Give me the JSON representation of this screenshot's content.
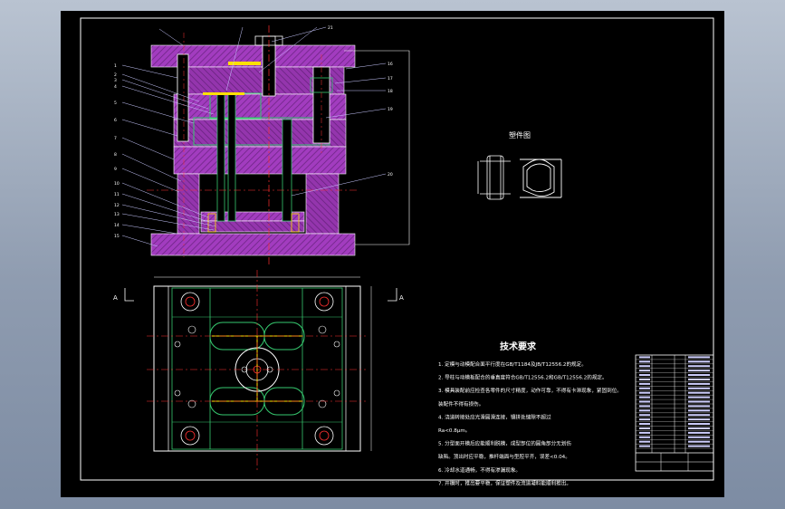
{
  "drawing": {
    "background_color": "#000000",
    "frame_color": "#ffffff",
    "line_colors": {
      "outline": "#ffffff",
      "plate": "#a23cbf",
      "plate_hatch": "#7a2f90",
      "part": "#36c96f",
      "centerline": "#ff3030",
      "section": "#ffe000",
      "leader": "#3a5cff"
    }
  },
  "section_view": {
    "balloons_left": [
      "1",
      "2",
      "3",
      "4",
      "5",
      "6",
      "7",
      "8",
      "9",
      "10",
      "11",
      "12",
      "13",
      "14",
      "15"
    ],
    "balloons_right": [
      "16",
      "17",
      "18",
      "19",
      "20",
      "21"
    ]
  },
  "plan_view": {
    "section_marks": [
      "A",
      "A"
    ]
  },
  "product_view": {
    "title": "塑件图"
  },
  "technical_requirements": {
    "title": "技术要求",
    "items": [
      "1. 定模与动模配合面平行度在GB/T1184及JB/T12556.2的规定。",
      "2. 导柱与动模板配合的垂直度符合GB/T12556.2和GB/T12556.2的规定。",
      "3. 模具装配前应检查各零件的尺寸精度，动作可靠，不得有卡滞现象，紧固到位。",
      "   装配件不得有损伤。",
      "4. 浇道转接处应光滑圆滑连接，镶拼处缝隙不超过",
      "   Ra<0.8μm。",
      "5. 分型面开模后应能顺利脱模，成型部位的圆角部分无划伤",
      "   缺陷。顶出时应平稳，推杆端面与型腔平齐，误差<0.04。",
      "6. 冷却水道通畅，不得有渗漏现象。",
      "7. 开模时，推出要平稳，保证塑件及流道凝料能顺利推出。"
    ]
  },
  "title_block": {
    "rows": 22
  }
}
